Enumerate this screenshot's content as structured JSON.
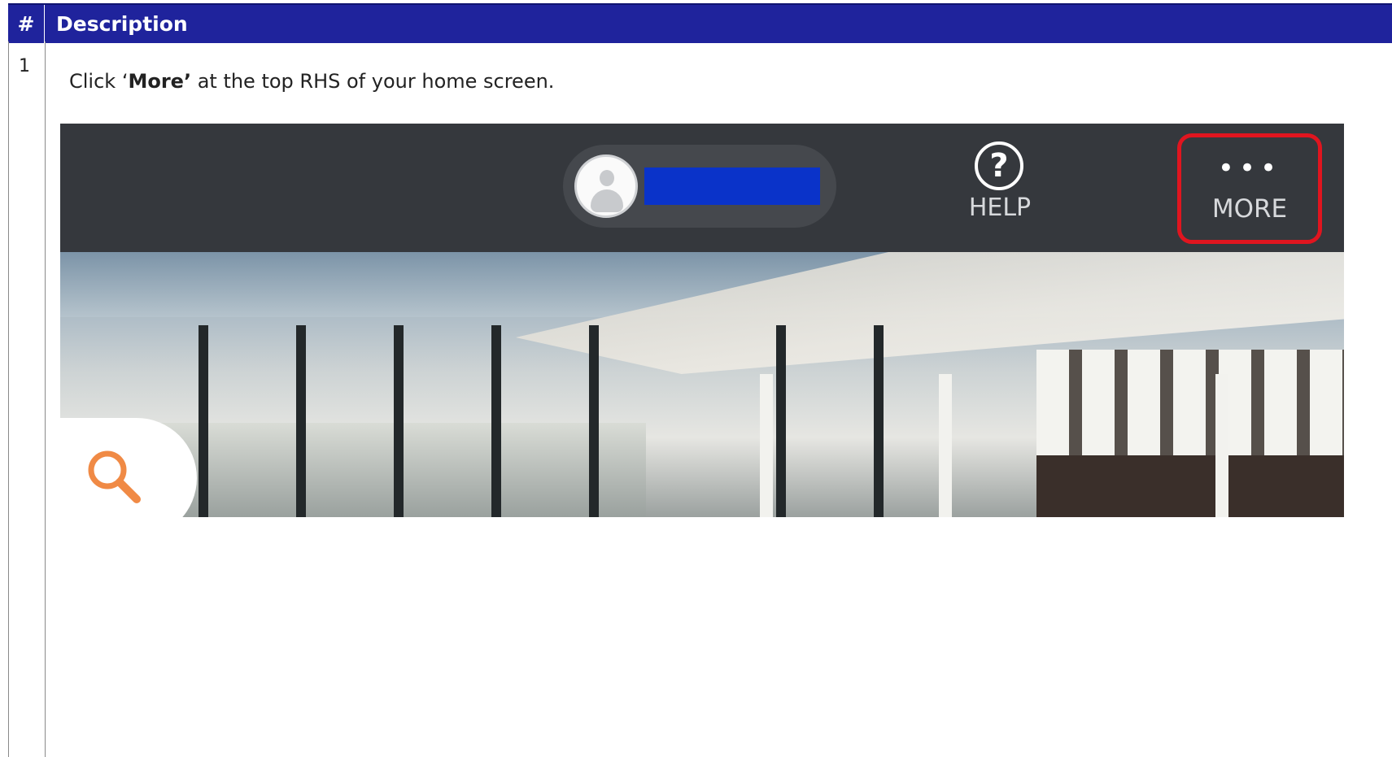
{
  "table": {
    "header": {
      "number": "#",
      "description": "Description"
    },
    "rows": [
      {
        "number": "1",
        "instruction": {
          "before": "Click ‘",
          "bold": "More’",
          "after": " at the top RHS of your home screen."
        }
      }
    ]
  },
  "screenshot": {
    "help_label": "HELP",
    "more_dots": "•••",
    "more_label": "MORE",
    "help_glyph": "?",
    "colors": {
      "topbar": "#35383d",
      "highlight": "#e0151f",
      "username_redaction": "#0a33c9",
      "search_icon": "#f08a45",
      "header": "#1f239c"
    }
  }
}
